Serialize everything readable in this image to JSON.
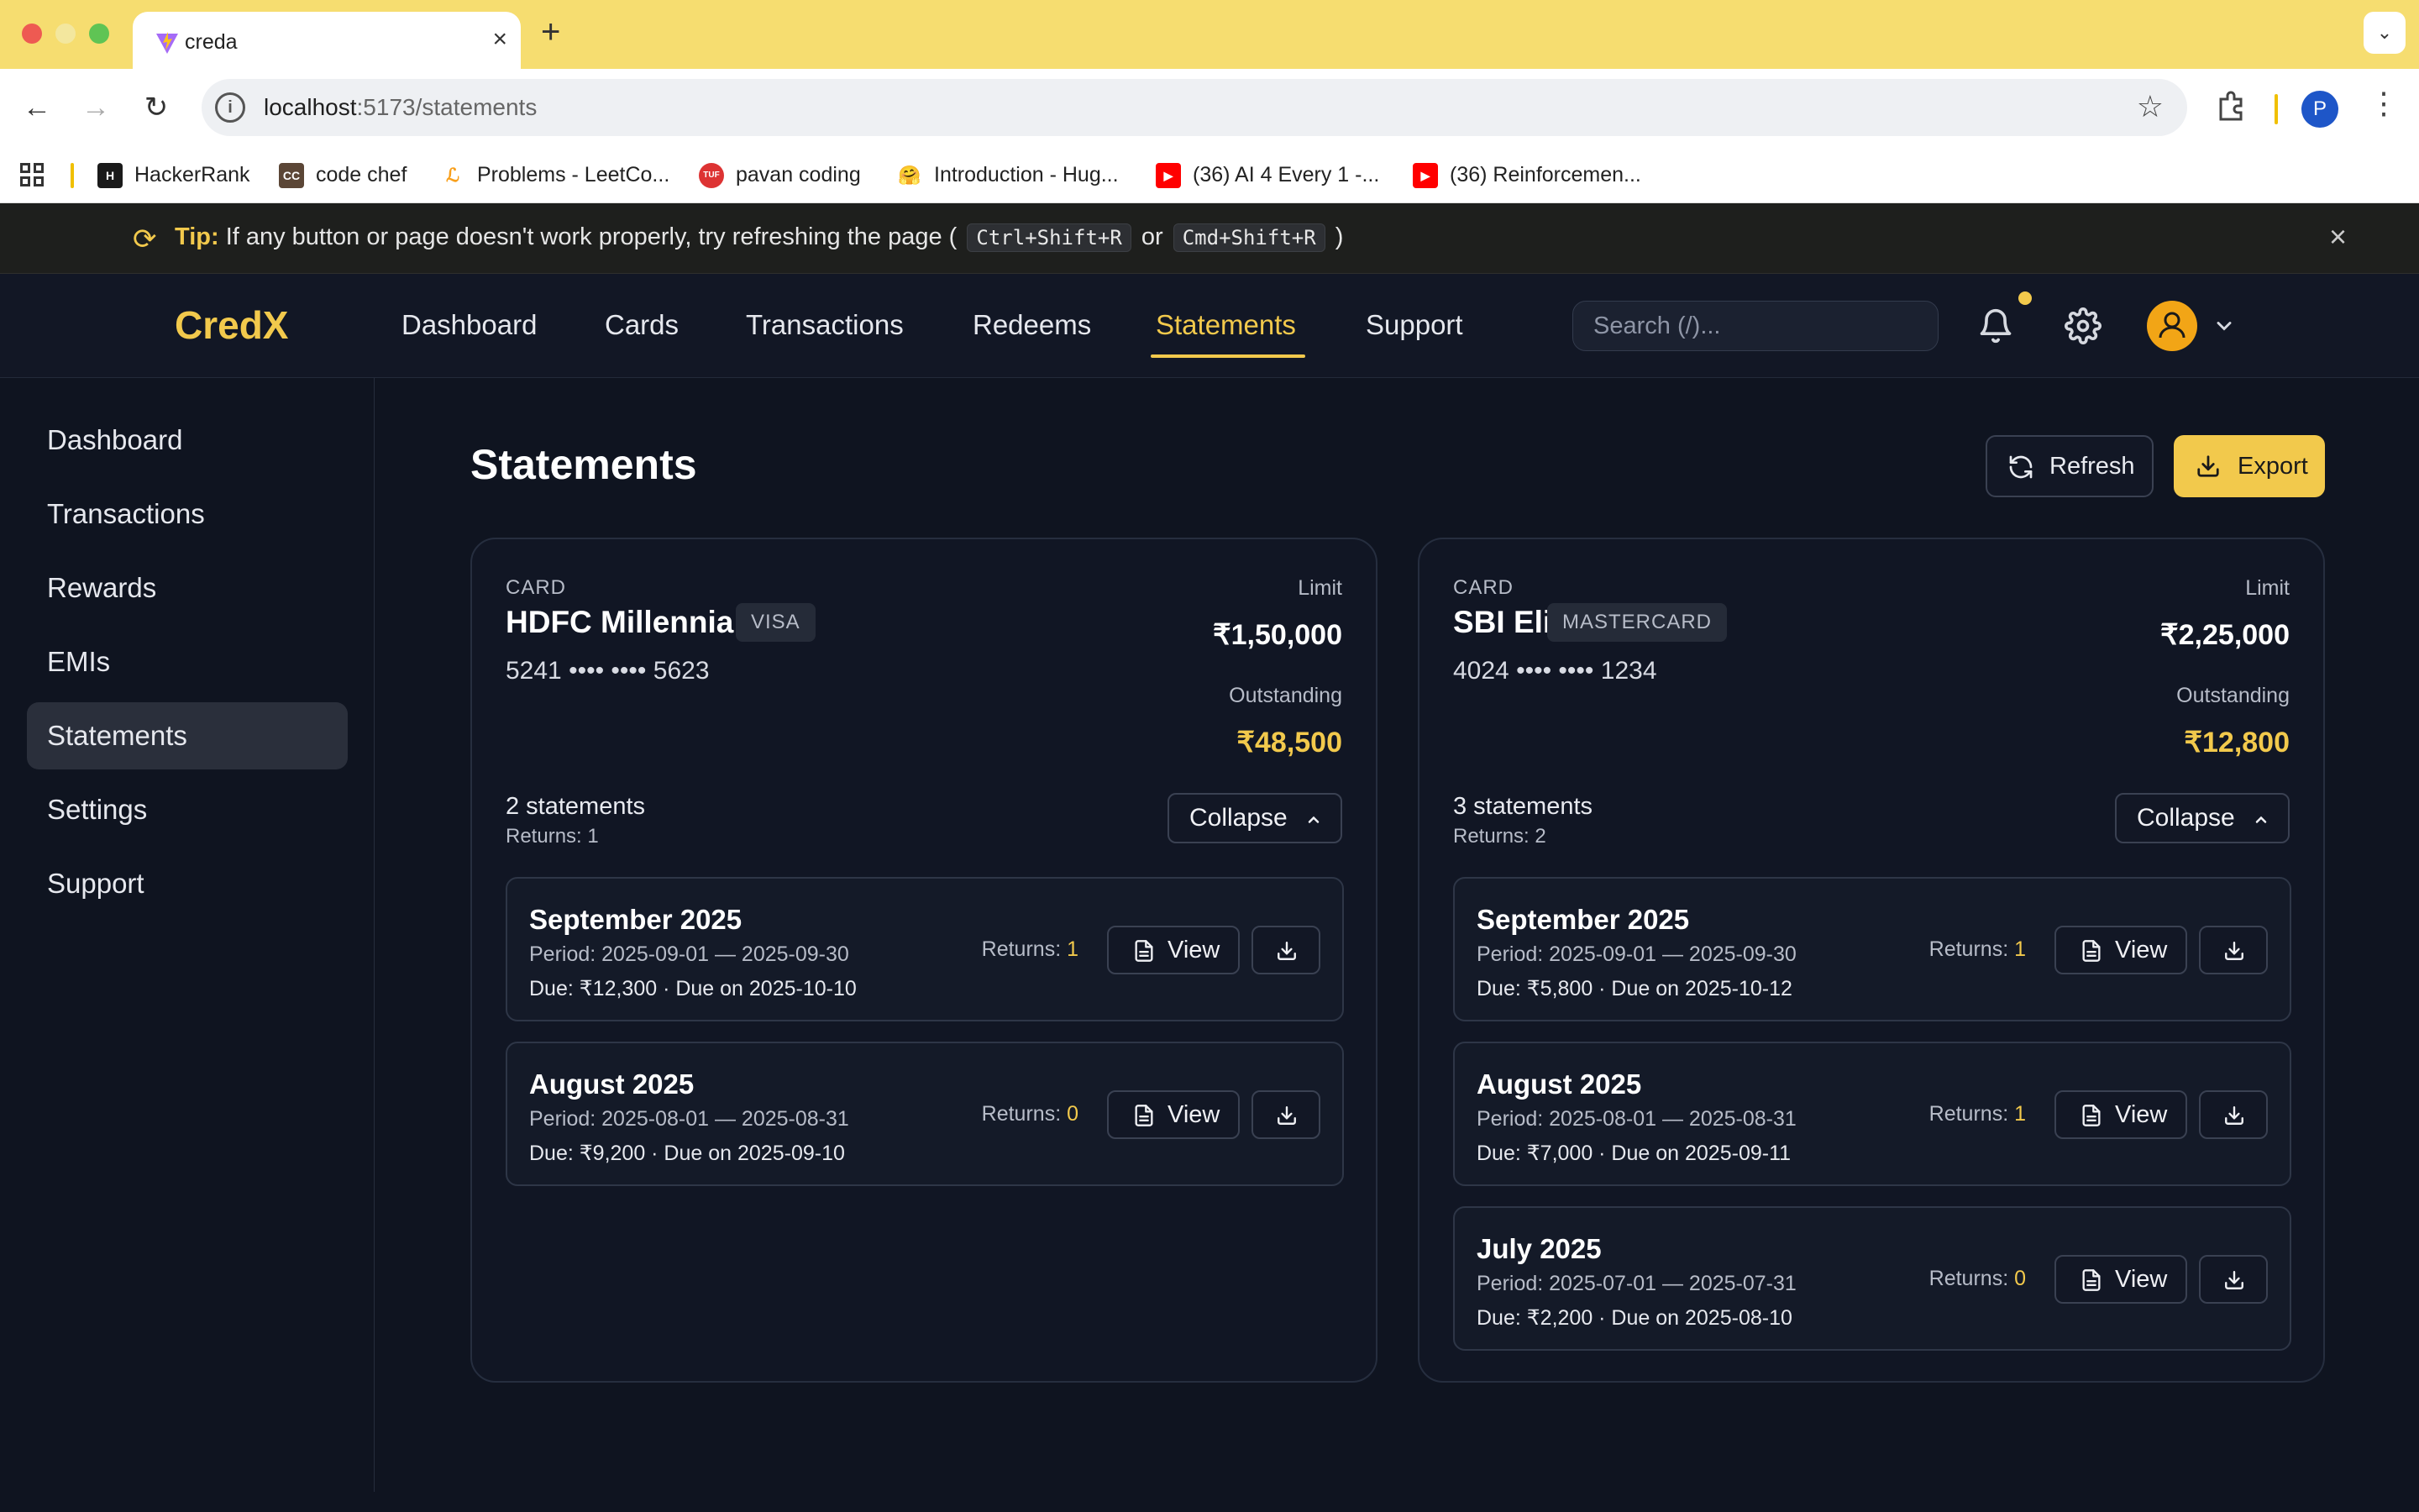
{
  "browser": {
    "tab_title": "creda",
    "url_host": "localhost",
    "url_path": ":5173/statements",
    "profile_initial": "P",
    "bookmarks": [
      {
        "label": "HackerRank",
        "icon_text": "H",
        "icon_color": "#1a1a1a"
      },
      {
        "label": "code chef",
        "icon_text": "CC",
        "icon_color": "#5b4636"
      },
      {
        "label": "Problems - LeetCo...",
        "icon_text": "L",
        "icon_color": "#ffffff"
      },
      {
        "label": "pavan coding",
        "icon_text": "TUF",
        "icon_color": "#d33"
      },
      {
        "label": "Introduction - Hug...",
        "icon_text": "🤗",
        "icon_color": "#ffffff"
      },
      {
        "label": "(36) AI 4 Every 1 -...",
        "icon_text": "▶",
        "icon_color": "#ff0000"
      },
      {
        "label": "(36) Reinforcemen...",
        "icon_text": "▶",
        "icon_color": "#ff0000"
      }
    ]
  },
  "tip": {
    "label": "Tip:",
    "text": "If any button or page doesn't work properly, try refreshing the page (",
    "kbd1": "Ctrl+Shift+R",
    "or": "or",
    "kbd2": "Cmd+Shift+R",
    "close_paren": ")"
  },
  "header": {
    "brand": "CredX",
    "nav": [
      "Dashboard",
      "Cards",
      "Transactions",
      "Redeems",
      "Statements",
      "Support"
    ],
    "active_nav": "Statements",
    "search_placeholder": "Search (/)..."
  },
  "sidebar": {
    "items": [
      "Dashboard",
      "Transactions",
      "Rewards",
      "EMIs",
      "Statements",
      "Settings",
      "Support"
    ],
    "active": "Statements"
  },
  "main": {
    "title": "Statements",
    "refresh_label": "Refresh",
    "export_label": "Export",
    "card_label": "CARD",
    "limit_label": "Limit",
    "outstanding_label": "Outstanding",
    "collapse_label": "Collapse",
    "view_label": "View",
    "returns_label": "Returns:",
    "cards": [
      {
        "name": "HDFC Millennia",
        "network": "VISA",
        "number": "5241 •••• •••• 5623",
        "limit": "₹1,50,000",
        "outstanding": "₹48,500",
        "count": "2 statements",
        "returns": "Returns: 1",
        "statements": [
          {
            "title": "September 2025",
            "period": "Period: 2025-09-01 — 2025-09-30",
            "due": "Due: ₹12,300 · Due on 2025-10-10",
            "returns": "1"
          },
          {
            "title": "August 2025",
            "period": "Period: 2025-08-01 — 2025-08-31",
            "due": "Due: ₹9,200 · Due on 2025-09-10",
            "returns": "0"
          }
        ]
      },
      {
        "name": "SBI Elite",
        "network": "MASTERCARD",
        "number": "4024 •••• •••• 1234",
        "limit": "₹2,25,000",
        "outstanding": "₹12,800",
        "count": "3 statements",
        "returns": "Returns: 2",
        "statements": [
          {
            "title": "September 2025",
            "period": "Period: 2025-09-01 — 2025-09-30",
            "due": "Due: ₹5,800 · Due on 2025-10-12",
            "returns": "1"
          },
          {
            "title": "August 2025",
            "period": "Period: 2025-08-01 — 2025-08-31",
            "due": "Due: ₹7,000 · Due on 2025-09-11",
            "returns": "1"
          },
          {
            "title": "July 2025",
            "period": "Period: 2025-07-01 — 2025-07-31",
            "due": "Due: ₹2,200 · Due on 2025-08-10",
            "returns": "0"
          }
        ]
      }
    ]
  },
  "colors": {
    "accent": "#f2c94c",
    "background": "#0f1420",
    "panel": "#111624"
  }
}
